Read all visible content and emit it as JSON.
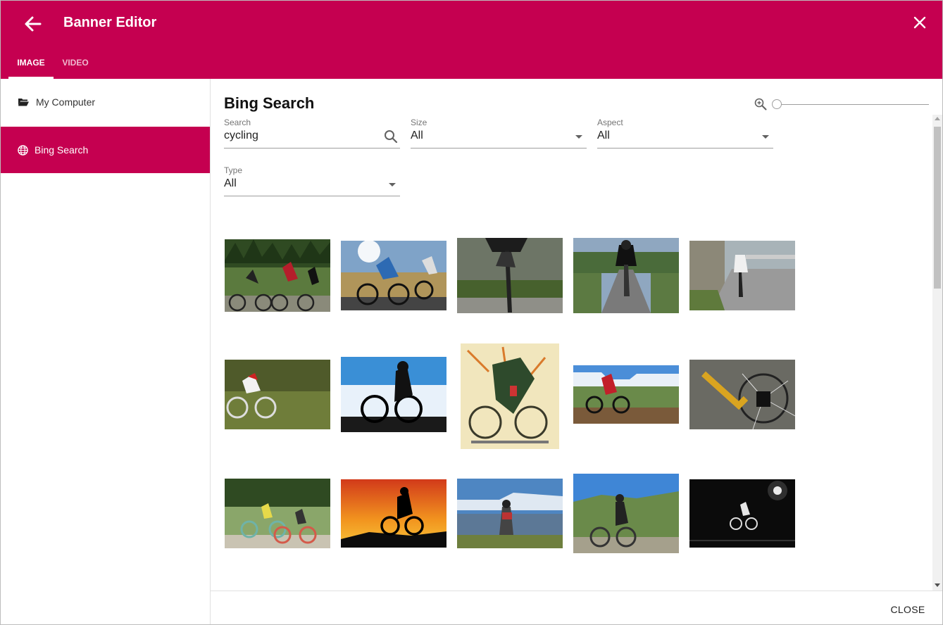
{
  "header": {
    "title": "Banner Editor",
    "accent": "#c50050"
  },
  "tabs": [
    {
      "label": "IMAGE",
      "active": true
    },
    {
      "label": "VIDEO",
      "active": false
    }
  ],
  "sidebar": {
    "items": [
      {
        "label": "My Computer",
        "icon": "folder-open-icon",
        "active": false
      },
      {
        "label": "Bing Search",
        "icon": "globe-icon",
        "active": true
      }
    ]
  },
  "main": {
    "title": "Bing Search",
    "zoom_icon": "zoom-in-icon",
    "zoom_level": 0,
    "filters": {
      "search": {
        "label": "Search",
        "value": "cycling"
      },
      "size": {
        "label": "Size",
        "value": "All"
      },
      "aspect": {
        "label": "Aspect",
        "value": "All"
      },
      "type": {
        "label": "Type",
        "value": "All"
      }
    },
    "results": [
      "group of road cyclists riding through forest",
      "road cyclists riding at sunrise",
      "cyclist close-up on road",
      "cyclist riding toward camera on road",
      "cyclist on mountain road near rock wall",
      "cyclist riding on grass motion blur",
      "cyclist silhouette against blue sky",
      "vintage cycling illustration poster",
      "mountain biker on wooden ramp",
      "bicycle wheel close-up yellow frame",
      "two people riding bikes on path",
      "cyclist silhouette at sunset",
      "cyclist looking over valley",
      "mountain biker on hilltop",
      "cyclist at night black and white"
    ]
  },
  "footer": {
    "close_label": "CLOSE"
  }
}
